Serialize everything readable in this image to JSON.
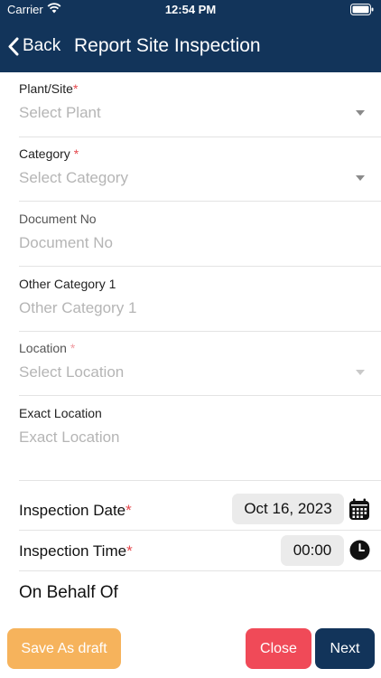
{
  "status_bar": {
    "carrier": "Carrier",
    "time": "12:54 PM"
  },
  "nav": {
    "back_label": "Back",
    "title": "Report Site Inspection"
  },
  "fields": {
    "plant": {
      "label": "Plant/Site",
      "required_mark": "*",
      "placeholder": "Select Plant"
    },
    "category": {
      "label": "Category ",
      "required_mark": "*",
      "placeholder": "Select Category"
    },
    "document_no": {
      "label": "Document No",
      "placeholder": "Document No"
    },
    "other_category": {
      "label": "Other Category 1",
      "placeholder": "Other Category 1"
    },
    "location": {
      "label": "Location ",
      "required_mark": "*",
      "placeholder": "Select Location"
    },
    "exact_location": {
      "label": "Exact Location",
      "placeholder": "Exact Location"
    }
  },
  "inspection_date": {
    "label": "Inspection Date",
    "required_mark": "*",
    "value": "Oct 16, 2023",
    "icon": "calendar-icon"
  },
  "inspection_time": {
    "label": "Inspection Time",
    "required_mark": "*",
    "value": "00:00",
    "icon": "clock-icon"
  },
  "on_behalf_of": {
    "title": "On Behalf Of"
  },
  "footer": {
    "save_draft_label": "Save As draft",
    "close_label": "Close",
    "next_label": "Next"
  },
  "colors": {
    "header": "#12345a",
    "save_draft": "#f6b35c",
    "close": "#f04a58",
    "next": "#12345a",
    "required": "#e5484d"
  }
}
